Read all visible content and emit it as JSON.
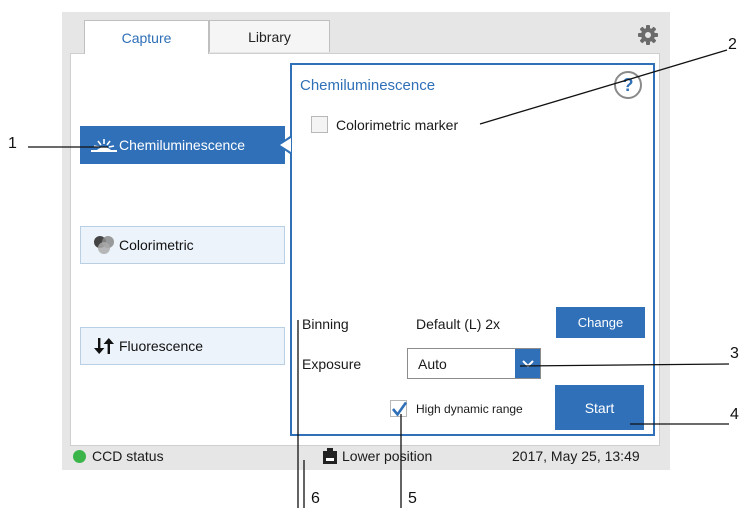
{
  "tabs": [
    {
      "label": "Capture",
      "active": true
    },
    {
      "label": "Library",
      "active": false
    }
  ],
  "modes": [
    {
      "label": "Chemiluminescence",
      "icon": "chemiluminescence-icon",
      "active": true
    },
    {
      "label": "Colorimetric",
      "icon": "colorimetric-icon",
      "active": false
    },
    {
      "label": "Fluorescence",
      "icon": "fluorescence-arrows-icon",
      "active": false
    }
  ],
  "panel": {
    "title": "Chemiluminescence",
    "help_symbol": "?",
    "colorimetric_marker": {
      "label": "Colorimetric marker",
      "checked": false
    },
    "binning": {
      "label": "Binning",
      "value": "Default (L) 2x",
      "button": "Change"
    },
    "exposure": {
      "label": "Exposure",
      "selected": "Auto"
    },
    "high_dynamic_range": {
      "label": "High dynamic range",
      "checked": true
    },
    "start_button": "Start"
  },
  "status": {
    "ccd": "CCD status",
    "position": "Lower position",
    "datetime": "2017, May 25, 13:49"
  },
  "callouts": [
    "1",
    "2",
    "3",
    "4",
    "5",
    "6"
  ],
  "colors": {
    "accent": "#2f70b8",
    "status_ok": "#3bb54a"
  }
}
